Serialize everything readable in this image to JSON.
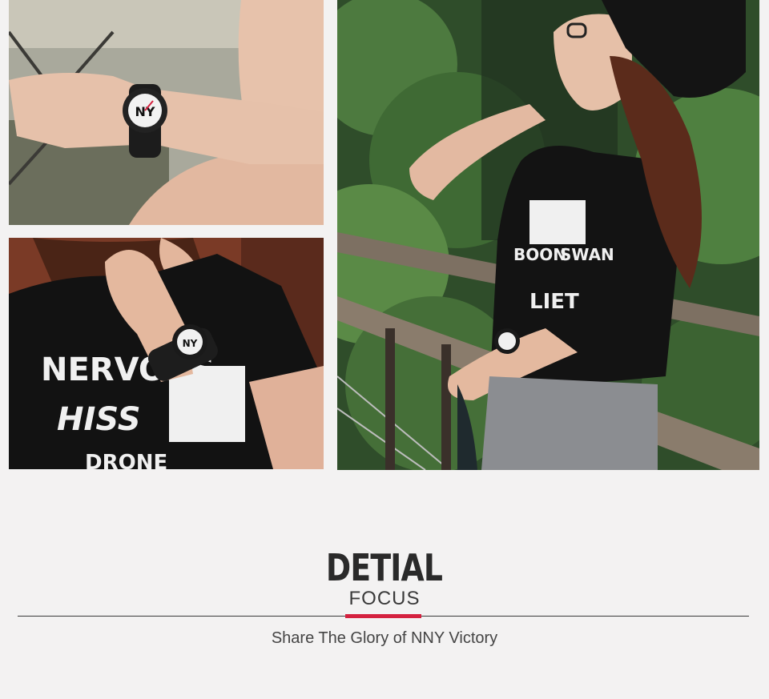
{
  "photos": {
    "wrist": {
      "alt": "wrist with watch"
    },
    "tshirt": {
      "alt": "watch on wrist with black t-shirt"
    },
    "stairs": {
      "alt": "woman in beanie leaning on railing"
    }
  },
  "shirt_print": {
    "line1": "NERVOUS",
    "line2": "HISS",
    "line3": "DRONE",
    "stairs_line1": "BOON",
    "stairs_line2": "SWAN",
    "stairs_line3": "LIET"
  },
  "section": {
    "title": "DETIAL",
    "subtitle": "FOCUS",
    "tagline": "Share The Glory of NNY Victory"
  },
  "colors": {
    "background": "#f3f2f2",
    "accent": "#d4213f",
    "text": "#2a2a2a"
  }
}
